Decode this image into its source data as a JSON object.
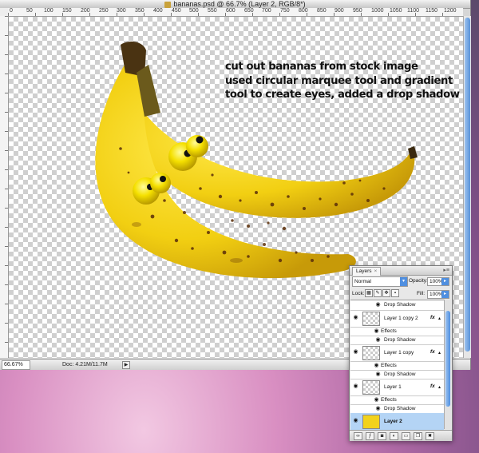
{
  "window": {
    "title": "bananas.psd @ 66.7% (Layer 2, RGB/8*)",
    "ruler_ticks": [
      "0",
      "50",
      "100",
      "150",
      "200",
      "250",
      "300",
      "350",
      "400",
      "450",
      "500",
      "550",
      "600",
      "650",
      "700",
      "750",
      "800",
      "850",
      "900",
      "950",
      "1000",
      "1050",
      "1100",
      "1150",
      "1200"
    ]
  },
  "canvas": {
    "annotation_lines": [
      "cut out bananas from stock image",
      "used circular marquee tool and gradient",
      "tool to create eyes, added a drop shadow"
    ]
  },
  "status": {
    "zoom": "66.67%",
    "doc": "Doc: 4.21M/11.7M",
    "arrow": "▶"
  },
  "layers_panel": {
    "tab_label": "Layers",
    "tab_close": "×",
    "menu_icon": "▸≡",
    "blend_mode": "Normal",
    "opacity_label": "Opacity:",
    "opacity_value": "100%",
    "lock_label": "Lock:",
    "fill_label": "Fill:",
    "fill_value": "100%",
    "top_effect": "Drop Shadow",
    "layers": [
      {
        "name": "Layer 1 copy 2",
        "fx": "fx",
        "effects_label": "Effects",
        "effect": "Drop Shadow"
      },
      {
        "name": "Layer 1 copy",
        "fx": "fx",
        "effects_label": "Effects",
        "effect": "Drop Shadow"
      },
      {
        "name": "Layer 1",
        "fx": "fx",
        "effects_label": "Effects",
        "effect": "Drop Shadow"
      },
      {
        "name": "Layer 2",
        "selected": true
      }
    ],
    "icons": [
      "eye-icon",
      "link-icon",
      "fx-icon",
      "mask-icon",
      "adjustment-icon",
      "folder-icon",
      "new-layer-icon",
      "trash-icon"
    ]
  },
  "colors": {
    "banana_yellow": "#f2d21c",
    "selection_blue": "#b4d4f5",
    "scroll_blue": "#4f8fe0"
  }
}
